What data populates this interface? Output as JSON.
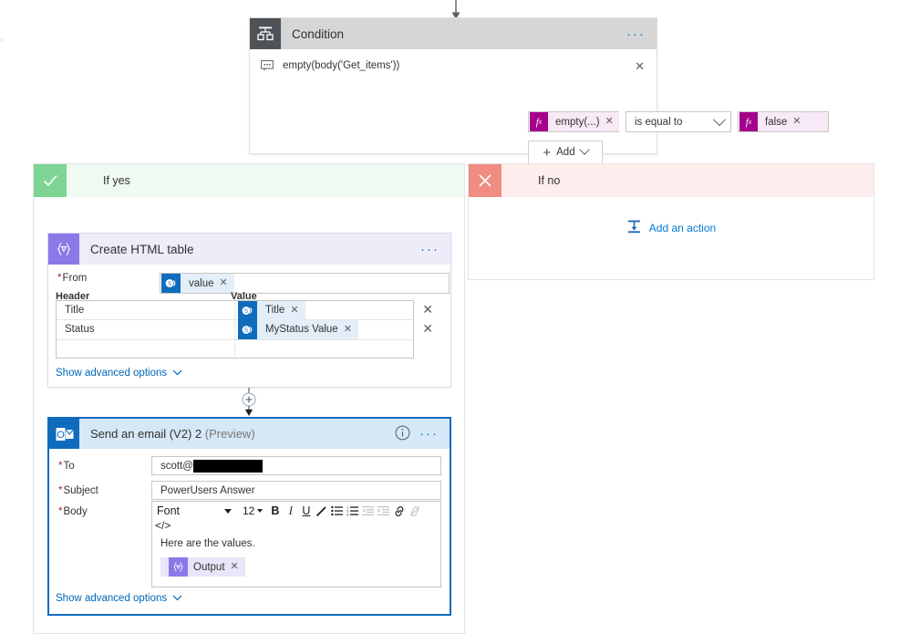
{
  "condition": {
    "title": "Condition",
    "icon": "condition-icon",
    "menu": "···",
    "expression": "empty(body('Get_items'))",
    "expression_icon": "expression-comment-icon",
    "close": "✕",
    "row": {
      "left_value": "empty(...)",
      "left_fx": "fx",
      "operator": "is equal to",
      "right_value": "false",
      "right_fx": "fx",
      "remove": "✕"
    },
    "add_button": "Add"
  },
  "branches": {
    "yes": {
      "label": "If yes",
      "icon": "checkmark-icon"
    },
    "no": {
      "label": "If no",
      "icon": "close-x-icon",
      "add_action": "Add an action",
      "add_action_icon": "add-action-icon"
    }
  },
  "html_table": {
    "title": "Create HTML table",
    "icon": "data-operation-icon",
    "menu": "···",
    "from_label": "From",
    "from_required": "*",
    "from_token": "value",
    "from_token_icon": "sharepoint-icon",
    "col_header_key": "Header",
    "col_header_value": "Value",
    "rows": [
      {
        "key": "Title",
        "value": "Title",
        "value_icon": "sharepoint-icon",
        "delete": "✕"
      },
      {
        "key": "Status",
        "value": "MyStatus Value",
        "value_icon": "sharepoint-icon",
        "delete": "✕"
      },
      {
        "key": "",
        "value": "",
        "value_icon": "",
        "delete": ""
      }
    ],
    "show_advanced": "Show advanced options"
  },
  "email": {
    "title": "Send an email (V2) 2",
    "preview_tag": "(Preview)",
    "icon": "outlook-icon",
    "info_icon": "info-icon",
    "menu": "···",
    "to_label": "To",
    "to_value": "scott@",
    "to_redacted": true,
    "subject_label": "Subject",
    "subject_value": "PowerUsers Answer",
    "body_label": "Body",
    "required_star": "*",
    "toolbar": {
      "font_name": "Font",
      "font_size": "12",
      "bold": "B",
      "italic": "I",
      "underline": "U",
      "highlight_icon": "pen-highlight-icon",
      "bullet_list_icon": "bullet-list-icon",
      "numbered_list_icon": "numbered-list-icon",
      "outdent_icon": "outdent-icon",
      "indent_icon": "indent-icon",
      "link_icon": "link-icon",
      "unlink_icon": "unlink-icon",
      "code_view": "</>"
    },
    "body_text": "Here are the values.",
    "body_token": "Output",
    "body_token_icon": "data-operation-icon",
    "show_advanced": "Show advanced options"
  },
  "connectors": {
    "top_arrow": "down-arrow",
    "mid_plus": "+",
    "mid_arrow": "down-arrow"
  },
  "colors": {
    "condition_header": "#d6d6d6",
    "condition_icon": "#4e5358",
    "yes_green": "#7ed492",
    "yes_bg": "#effbf2",
    "no_red": "#f08c82",
    "no_bg": "#fdeeed",
    "purple": "#8a7ae8",
    "purple_bg": "#eeecf9",
    "sharepoint_blue": "#0f6cbd",
    "email_header_bg": "#d6e8f7",
    "fx_magenta": "#a4008c",
    "link_blue": "#0067b8"
  }
}
